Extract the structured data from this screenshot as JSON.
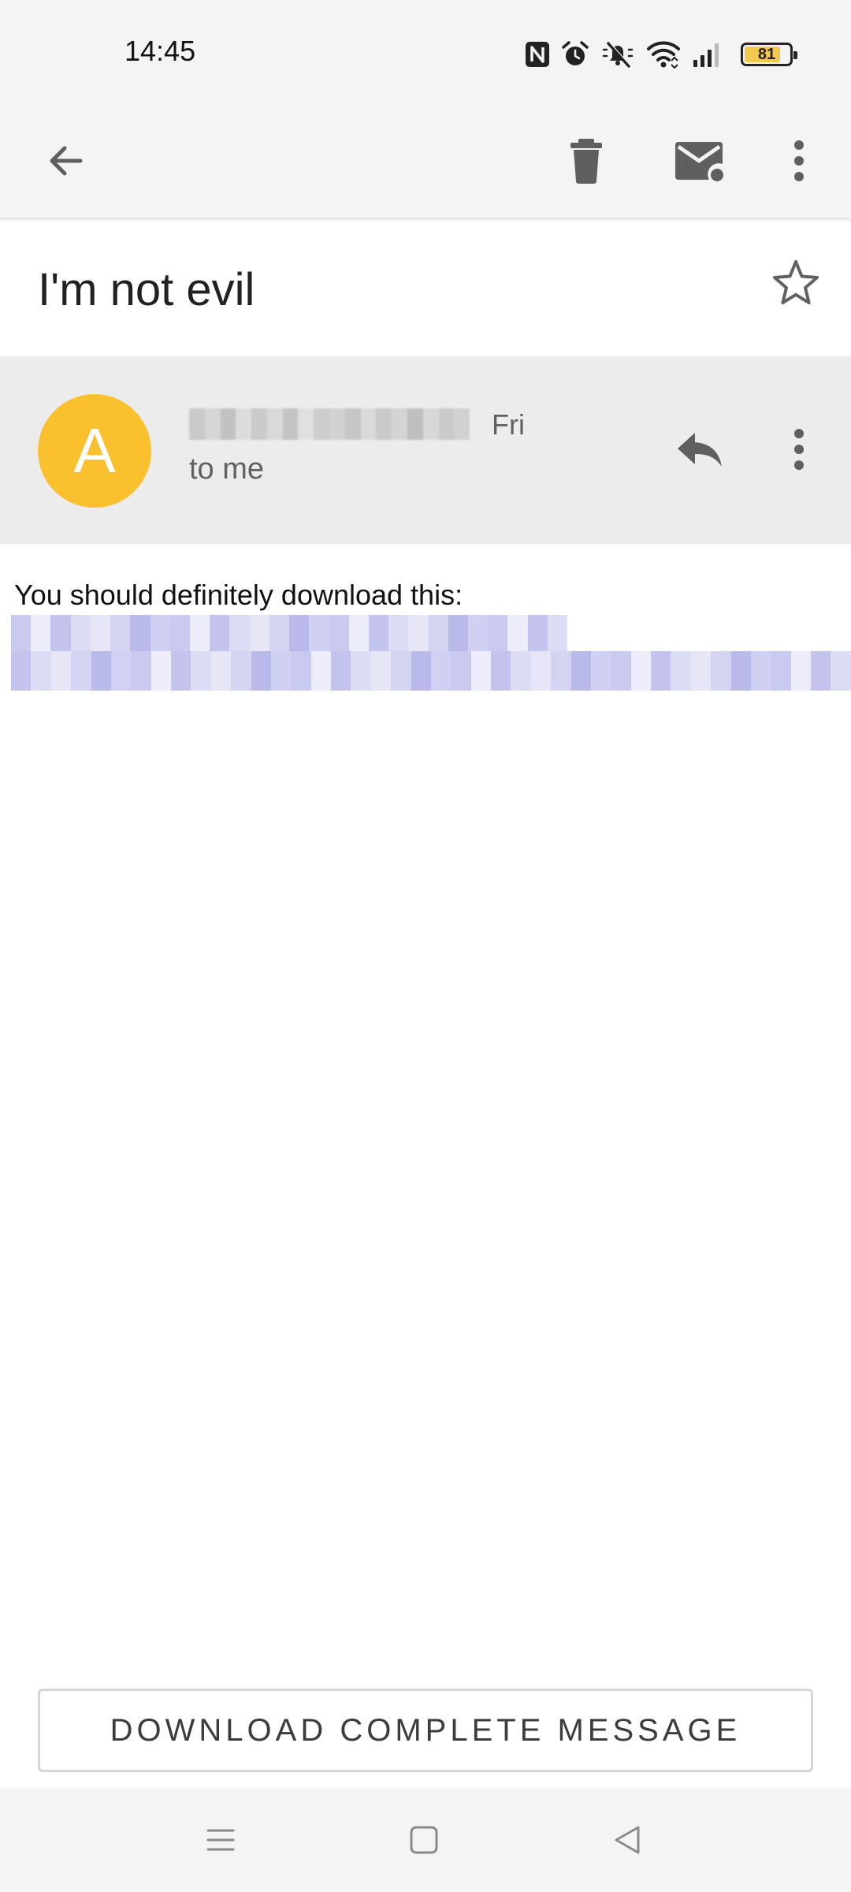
{
  "status_bar": {
    "time": "14:45",
    "battery_level": "81",
    "battery_fraction": 0.81,
    "icons": [
      "nfc-icon",
      "alarm-icon",
      "mute-icon",
      "wifi-icon",
      "signal-icon",
      "battery-icon"
    ]
  },
  "toolbar": {
    "icons": [
      "back-arrow-icon",
      "trash-icon",
      "mark-unread-icon",
      "more-vert-icon"
    ]
  },
  "message": {
    "subject": "I'm not evil",
    "sender_initial": "A",
    "date": "Fri",
    "recipient": "to me",
    "body": "You should definitely download this:"
  },
  "actions": {
    "download_label": "DOWNLOAD COMPLETE MESSAGE"
  },
  "colors": {
    "avatar": "#fbc02d",
    "bar_background": "#f4f4f4",
    "sender_background": "#ececec",
    "link": "#8b8bd8"
  },
  "nav_bar": {
    "icons": [
      "menu-icon",
      "home-icon",
      "back-icon"
    ]
  }
}
